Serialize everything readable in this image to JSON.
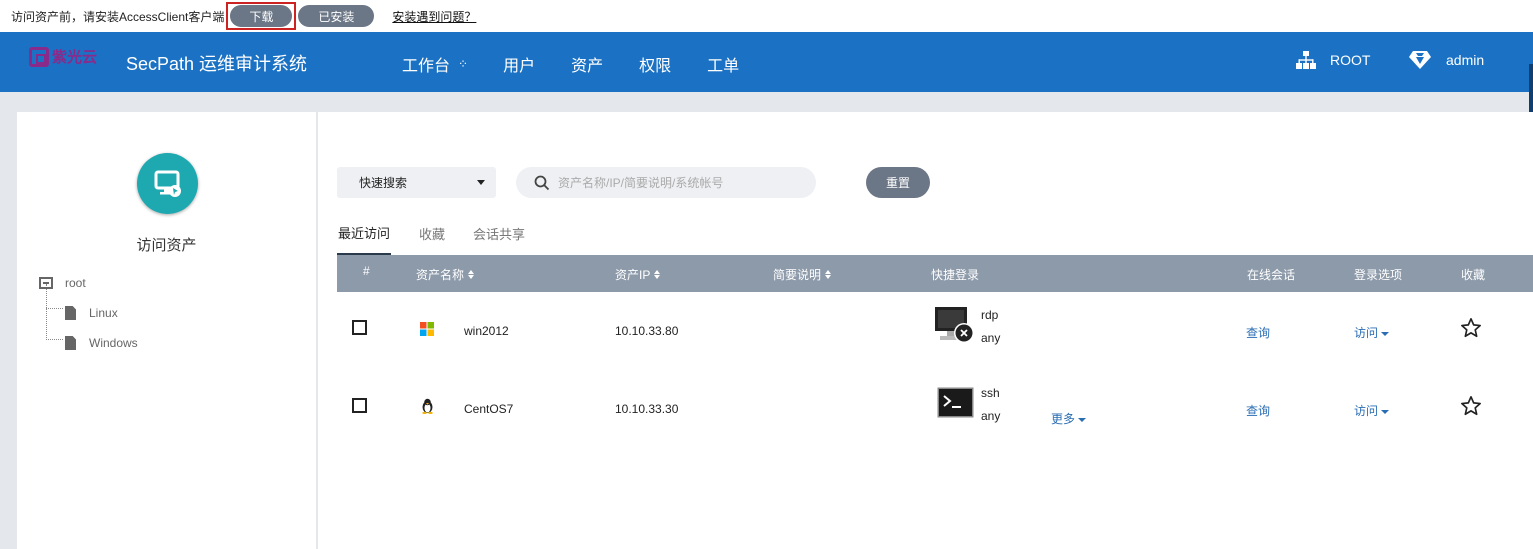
{
  "notice": {
    "text": "访问资产前，请安装AccessClient客户端",
    "download_label": "下载",
    "installed_label": "已安装",
    "help_link": "安装遇到问题？"
  },
  "header": {
    "logo_text": "紫光云",
    "app_title": "SecPath 运维审计系统",
    "nav": [
      "工作台",
      "用户",
      "资产",
      "权限",
      "工单"
    ],
    "org": "ROOT",
    "user": "admin"
  },
  "sidebar": {
    "title": "访问资产",
    "tree": {
      "root": "root",
      "children": [
        "Linux",
        "Windows"
      ]
    }
  },
  "toolbar": {
    "search_type": "快速搜索",
    "search_placeholder": "资产名称/IP/简要说明/系统帐号",
    "reset_label": "重置"
  },
  "tabs": [
    "最近访问",
    "收藏",
    "会话共享"
  ],
  "table": {
    "headers": {
      "index": "#",
      "name": "资产名称",
      "ip": "资产IP",
      "desc": "简要说明",
      "quick": "快捷登录",
      "online": "在线会话",
      "options": "登录选项",
      "fav": "收藏"
    },
    "rows": [
      {
        "os": "windows",
        "name": "win2012",
        "ip": "10.10.33.80",
        "protocol": "rdp",
        "account": "any",
        "more": "",
        "online": "查询",
        "options": "访问"
      },
      {
        "os": "linux",
        "name": "CentOS7",
        "ip": "10.10.33.30",
        "protocol": "ssh",
        "account": "any",
        "more": "更多",
        "online": "查询",
        "options": "访问"
      }
    ]
  },
  "colors": {
    "header_bg": "#1b72c4",
    "logo": "#8a2a8a",
    "table_head": "#8d9aaa",
    "pill": "#6b7686",
    "link": "#2a6db3",
    "accent_teal": "#1ea9b0"
  }
}
